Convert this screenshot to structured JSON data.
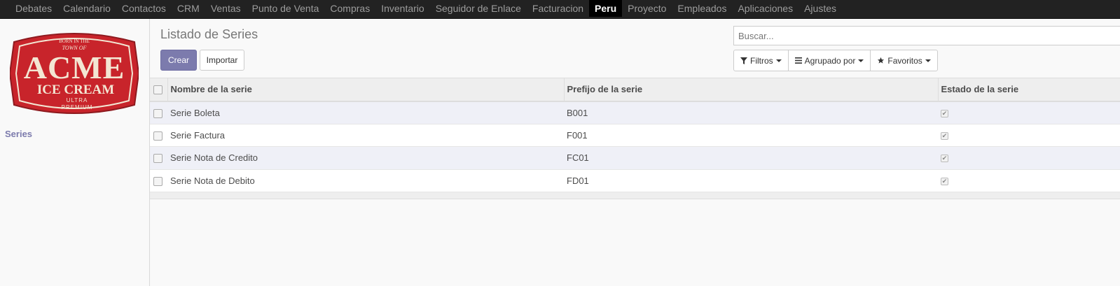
{
  "nav": {
    "items": [
      {
        "label": "Debates"
      },
      {
        "label": "Calendario"
      },
      {
        "label": "Contactos"
      },
      {
        "label": "CRM"
      },
      {
        "label": "Ventas"
      },
      {
        "label": "Punto de Venta"
      },
      {
        "label": "Compras"
      },
      {
        "label": "Inventario"
      },
      {
        "label": "Seguidor de Enlace"
      },
      {
        "label": "Facturacion"
      },
      {
        "label": "Peru",
        "active": true
      },
      {
        "label": "Proyecto"
      },
      {
        "label": "Empleados"
      },
      {
        "label": "Aplicaciones"
      },
      {
        "label": "Ajustes"
      }
    ]
  },
  "logo": {
    "brand": "ACME",
    "line2": "ICE CREAM",
    "line3": "ULTRA",
    "line4": "PREMIUM",
    "top": "BORN IN THE",
    "top2": "TOWN OF"
  },
  "sidebar": {
    "link": "Series"
  },
  "control_panel": {
    "title": "Listado de Series",
    "create_label": "Crear",
    "import_label": "Importar",
    "search_placeholder": "Buscar...",
    "filters_label": "Filtros",
    "groupby_label": "Agrupado por",
    "favorites_label": "Favoritos"
  },
  "table": {
    "columns": [
      "Nombre de la serie",
      "Prefijo de la serie",
      "Estado de la serie"
    ],
    "rows": [
      {
        "name": "Serie Boleta",
        "prefix": "B001",
        "state": true
      },
      {
        "name": "Serie Factura",
        "prefix": "F001",
        "state": true
      },
      {
        "name": "Serie Nota de Credito",
        "prefix": "FC01",
        "state": true
      },
      {
        "name": "Serie Nota de Debito",
        "prefix": "FD01",
        "state": true
      }
    ]
  },
  "colors": {
    "primary": "#7c7bad",
    "navbar": "#222222",
    "logo_red": "#c8242b"
  }
}
